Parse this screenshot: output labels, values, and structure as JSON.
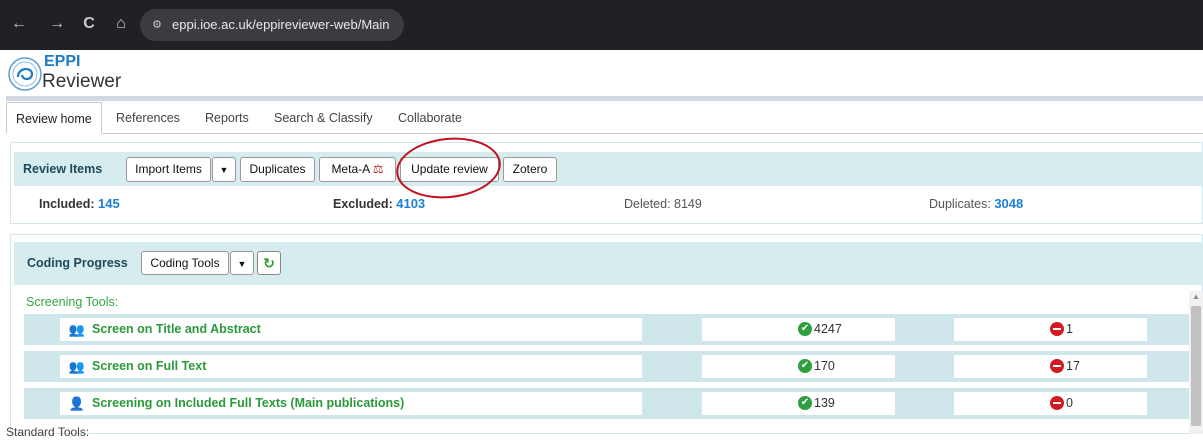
{
  "browser": {
    "url": "eppi.ioe.ac.uk/eppireviewer-web/Main",
    "back_glyph": "←",
    "forward_glyph": "→",
    "reload_glyph": "C",
    "home_glyph": "⌂",
    "site_info_glyph": "⚙"
  },
  "logo": {
    "line1": "EPPI",
    "line2": "Reviewer"
  },
  "tabs": [
    {
      "label": "Review home",
      "active": true
    },
    {
      "label": "References"
    },
    {
      "label": "Reports"
    },
    {
      "label": "Search & Classify"
    },
    {
      "label": "Collaborate"
    }
  ],
  "review_items": {
    "title": "Review Items",
    "buttons": {
      "import": "Import Items",
      "dropdown": "▼",
      "duplicates": "Duplicates",
      "meta": "Meta-A",
      "meta_icon": "⚖",
      "update": "Update review",
      "zotero": "Zotero"
    },
    "stats": {
      "included_label": "Included:",
      "included_value": "145",
      "excluded_label": "Excluded:",
      "excluded_value": "4103",
      "deleted_text": "Deleted: 8149",
      "duplicates_label": "Duplicates:",
      "duplicates_value": "3048"
    }
  },
  "coding_progress": {
    "title": "Coding Progress",
    "tools_button": "Coding Tools",
    "dropdown": "▼",
    "refresh_glyph": "↻",
    "screening_label": "Screening Tools:",
    "standard_label": "Standard Tools:",
    "tools": [
      {
        "name": "Screen on Title and Abstract",
        "icon_glyph": "👥",
        "included": "4247",
        "excluded": "1"
      },
      {
        "name": "Screen on Full Text",
        "icon_glyph": "👥",
        "included": "170",
        "excluded": "17"
      },
      {
        "name": "Screening on Included Full Texts (Main publications)",
        "icon_glyph": "👤",
        "included": "139",
        "excluded": "0"
      }
    ],
    "ok_glyph": "✔",
    "scroll_up_glyph": "▲"
  },
  "colors": {
    "accent_blue": "#1a7fd8",
    "panel_teal": "#d7ecef",
    "highlight_red": "#c0121e",
    "tool_green": "#2a9a3a"
  }
}
